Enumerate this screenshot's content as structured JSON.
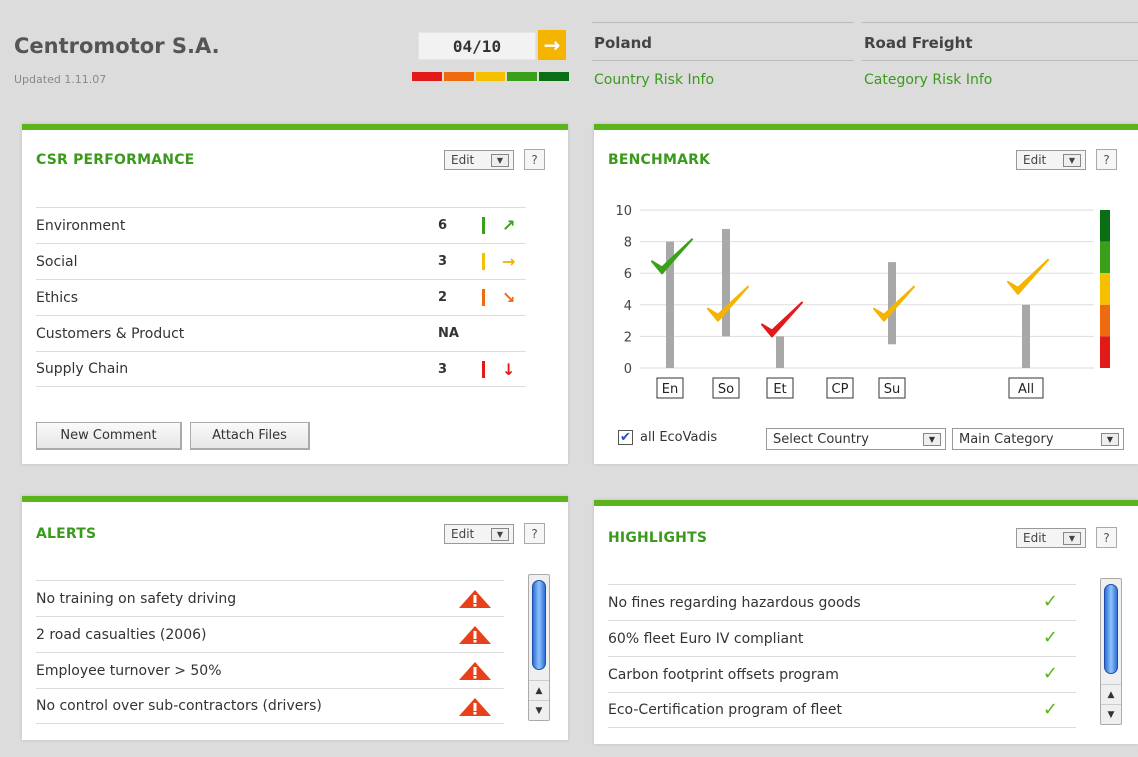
{
  "header": {
    "company": "Centromotor S.A.",
    "updated": "Updated 1.11.07",
    "score": "04/10",
    "score_arrow": "→",
    "score_colors": [
      "#e21a1a",
      "#f06a10",
      "#f5c000",
      "#3aa01a",
      "#0a6e14"
    ]
  },
  "country": {
    "name": "Poland",
    "link": "Country Risk Info"
  },
  "category": {
    "name": "Road Freight",
    "link": "Category Risk Info"
  },
  "csr": {
    "title": "CSR PERFORMANCE",
    "edit_label": "Edit",
    "help_label": "?",
    "rows": [
      {
        "label": "Environment",
        "score": "6",
        "bar_color": "#3aa01a",
        "trend": "↗",
        "trend_color": "#3aa01a"
      },
      {
        "label": "Social",
        "score": "3",
        "bar_color": "#f5c000",
        "trend": "→",
        "trend_color": "#f5b400"
      },
      {
        "label": "Ethics",
        "score": "2",
        "bar_color": "#f06a10",
        "trend": "↘",
        "trend_color": "#f06a10"
      },
      {
        "label": "Customers & Product",
        "score": "NA",
        "bar_color": "",
        "trend": "",
        "trend_color": ""
      },
      {
        "label": "Supply Chain",
        "score": "3",
        "bar_color": "#e21a1a",
        "trend": "↓",
        "trend_color": "#e21a1a"
      }
    ],
    "buttons": {
      "new_comment": "New Comment",
      "attach_files": "Attach Files"
    }
  },
  "benchmark": {
    "title": "BENCHMARK",
    "edit_label": "Edit",
    "help_label": "?",
    "all_label": "all EcoVadis",
    "select_country": "Select Country",
    "main_category": "Main Category",
    "scale_colors": [
      "#0a6e14",
      "#3aa01a",
      "#f5c000",
      "#f06a10",
      "#e21a1a"
    ]
  },
  "chart_data": {
    "type": "range-bar",
    "categories": [
      "En",
      "So",
      "Et",
      "CP",
      "Su",
      "All"
    ],
    "ylim": [
      0,
      10
    ],
    "yticks": [
      "0",
      "2",
      "4",
      "6",
      "8",
      "10"
    ],
    "ranges": [
      [
        0,
        8
      ],
      [
        2,
        8.8
      ],
      [
        0,
        2
      ],
      null,
      [
        1.5,
        6.7
      ],
      [
        0,
        4
      ]
    ],
    "marks": [
      {
        "category": "En",
        "value": 6.5,
        "color": "#3aa01a"
      },
      {
        "category": "So",
        "value": 3.5,
        "color": "#f5b400"
      },
      {
        "category": "Et",
        "value": 2.5,
        "color": "#e21a1a"
      },
      {
        "category": "Su",
        "value": 3.5,
        "color": "#f5b400"
      },
      {
        "category": "All",
        "value": 5.2,
        "color": "#f5b400"
      }
    ]
  },
  "alerts": {
    "title": "ALERTS",
    "edit_label": "Edit",
    "help_label": "?",
    "items": [
      "No training on safety driving",
      "2 road casualties (2006)",
      "Employee turnover > 50%",
      "No control over sub-contractors (drivers)"
    ]
  },
  "highlights": {
    "title": "HIGHLIGHTS",
    "edit_label": "Edit",
    "help_label": "?",
    "items": [
      "No fines regarding hazardous goods",
      "60% fleet Euro IV compliant",
      "Carbon footprint offsets program",
      "Eco-Certification program of fleet"
    ]
  }
}
